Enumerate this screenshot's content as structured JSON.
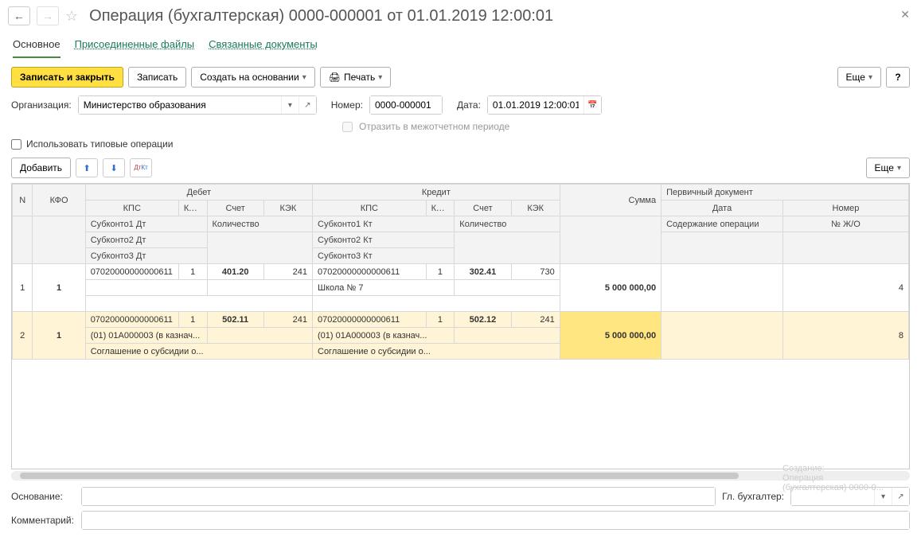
{
  "title": "Операция (бухгалтерская) 0000-000001 от 01.01.2019 12:00:01",
  "tabs": {
    "main": "Основное",
    "files": "Присоединенные файлы",
    "linked": "Связанные документы"
  },
  "buttons": {
    "save_close": "Записать и закрыть",
    "save": "Записать",
    "create_based": "Создать на основании",
    "print": "Печать",
    "more": "Еще",
    "help": "?",
    "add": "Добавить"
  },
  "form": {
    "org_label": "Организация:",
    "org_value": "Министерство образования",
    "number_label": "Номер:",
    "number_value": "0000-000001",
    "date_label": "Дата:",
    "date_value": "01.01.2019 12:00:01",
    "period_cb": "Отразить в межотчетном периоде",
    "typical_cb": "Использовать типовые операции"
  },
  "headers": {
    "n": "N",
    "kfo": "КФО",
    "debet": "Дебет",
    "kredit": "Кредит",
    "summa": "Сумма",
    "primary_doc": "Первичный документ",
    "kps": "КПС",
    "schet": "Счет",
    "kek": "КЭК",
    "data": "Дата",
    "nomer": "Номер",
    "quantity": "Количество",
    "sub1d": "Субконто1 Дт",
    "sub2d": "Субконто2 Дт",
    "sub3d": "Субконто3 Дт",
    "sub1k": "Субконто1 Кт",
    "sub2k": "Субконто2 Кт",
    "sub3k": "Субконто3 Кт",
    "soderzh": "Содержание операции",
    "zho": "№ Ж/О"
  },
  "rows": [
    {
      "n": "1",
      "kfo": "1",
      "d_kps": "07020000000000611",
      "d_kfo": "1",
      "d_schet": "401.20",
      "d_kek": "241",
      "k_kps": "07020000000000611",
      "k_kfo": "1",
      "k_schet": "302.41",
      "k_kek": "730",
      "sum": "5 000 000,00",
      "sub_k1": "Школа № 7",
      "zho": "4"
    },
    {
      "n": "2",
      "kfo": "1",
      "d_kps": "07020000000000611",
      "d_kfo": "1",
      "d_schet": "502.11",
      "d_kek": "241",
      "k_kps": "07020000000000611",
      "k_kfo": "1",
      "k_schet": "502.12",
      "k_kek": "241",
      "sum": "5 000 000,00",
      "sub_d1": "(01) 01А000003 (в казнач...",
      "sub_d2": "Соглашение о субсидии о...",
      "sub_k1": "(01) 01А000003 (в казнач...",
      "sub_k2": "Соглашение о субсидии о...",
      "zho": "8"
    }
  ],
  "bottom": {
    "base_label": "Основание:",
    "accountant_label": "Гл. бухгалтер:",
    "comment_label": "Комментарий:"
  },
  "ghost": {
    "l1": "Создание:",
    "l2": "Операция",
    "l3": "(бухгалтерская) 0000-0..."
  }
}
